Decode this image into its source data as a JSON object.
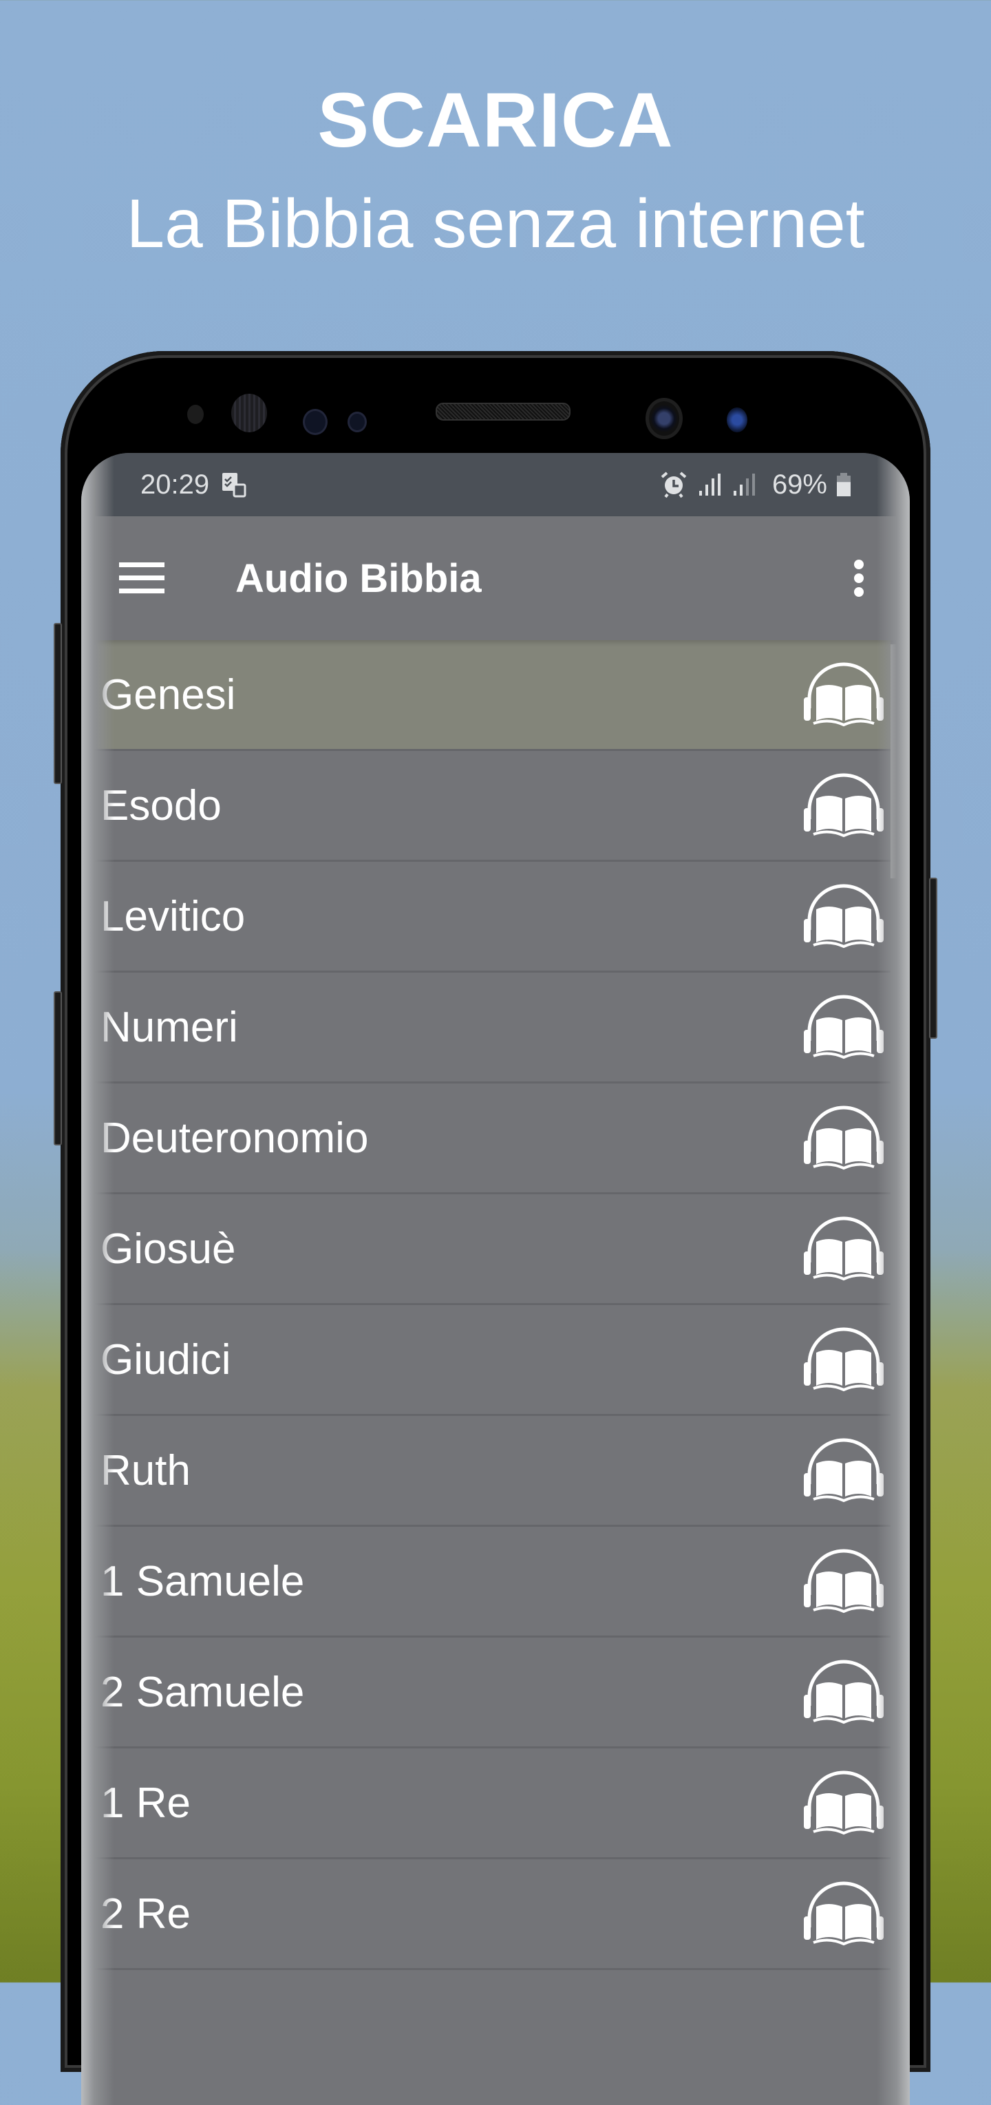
{
  "promo": {
    "headline": "SCARICA",
    "subheadline": "La Bibbia senza internet"
  },
  "statusbar": {
    "time": "20:29",
    "notification_icon": "task-sync-icon",
    "icons": [
      "alarm-icon",
      "signal-icon",
      "signal-icon"
    ],
    "battery_text": "69%",
    "battery_level": 0.69
  },
  "appbar": {
    "menu_icon": "hamburger-menu-icon",
    "title": "Audio Bibbia",
    "more_icon": "more-vert-icon"
  },
  "books": {
    "selected_index": 0,
    "item_icon": "audio-book-headphones-icon",
    "items": [
      {
        "label": "Genesi"
      },
      {
        "label": "Esodo"
      },
      {
        "label": "Levitico"
      },
      {
        "label": "Numeri"
      },
      {
        "label": "Deuteronomio"
      },
      {
        "label": "Giosuè"
      },
      {
        "label": "Giudici"
      },
      {
        "label": "Ruth"
      },
      {
        "label": "1 Samuele"
      },
      {
        "label": "2 Samuele"
      },
      {
        "label": "1 Re"
      },
      {
        "label": "2 Re"
      }
    ]
  },
  "colors": {
    "appbar": "#737478",
    "statusbar": "#4b5057",
    "selected_row": "#83857a",
    "divider": "#65666a",
    "text": "#ffffff"
  }
}
